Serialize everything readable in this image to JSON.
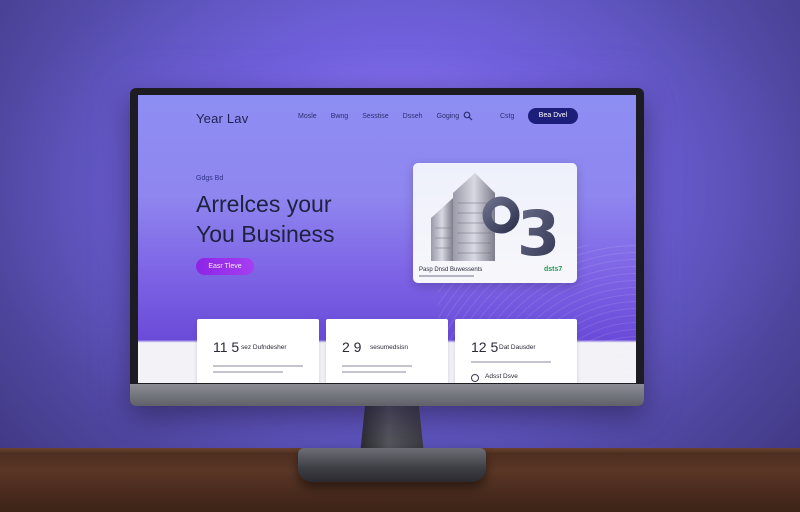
{
  "nav": {
    "logo": "Year Lav",
    "links": [
      "Mosle",
      "Bwng",
      "Sesstise",
      "Dsseh",
      "Goging"
    ],
    "search_icon": "search-icon",
    "plain_link": "Cstg",
    "cta_label": "Bea Dvel"
  },
  "hero": {
    "eyebrow": "Gdgs Bd",
    "headline_line1": "Arrelces your",
    "headline_line2": "You Business",
    "button_label": "Easr Tleve"
  },
  "hero_card": {
    "numeral": "3",
    "caption": "Pasp Dnsd Buwessents",
    "badge": "dsts7"
  },
  "stats": [
    {
      "value": "11 5",
      "label": "sez Dufndesher",
      "footer": ""
    },
    {
      "value": "2 9",
      "label": "sesumedsisn",
      "footer": ""
    },
    {
      "value": "12 5",
      "label": "Dat Dausder",
      "footer": "Adsst Dsve"
    }
  ],
  "colors": {
    "nav_cta": "#1d1d7a",
    "hero_button": "#9a2fee",
    "headline": "#1e2140"
  }
}
